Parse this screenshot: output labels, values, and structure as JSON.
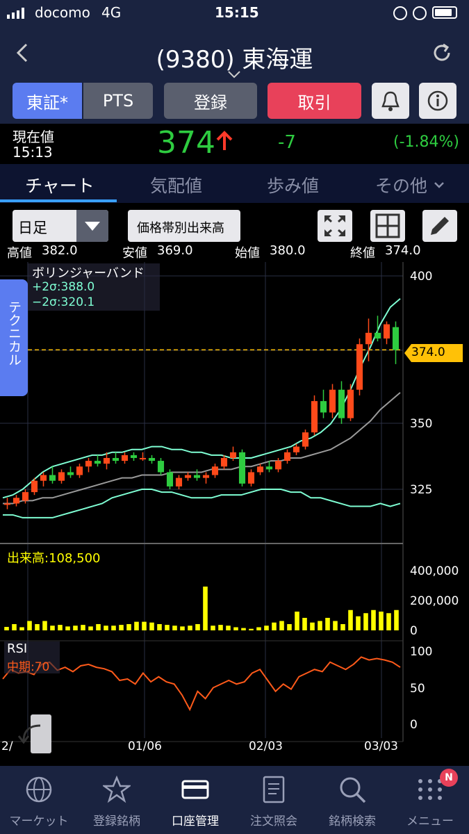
{
  "status": {
    "carrier": "docomo",
    "network": "4G",
    "time": "15:15"
  },
  "nav": {
    "title": "(9380) 東海運"
  },
  "buttons": {
    "tse": "東証*",
    "pts": "PTS",
    "register": "登録",
    "trade": "取引"
  },
  "price": {
    "label": "現在値",
    "time": "15:13",
    "value": "374",
    "change": "-7",
    "change_pct": "(-1.84%)"
  },
  "tabs": [
    "チャート",
    "気配値",
    "歩み値",
    "その他"
  ],
  "chart_tools": {
    "period": "日足",
    "volume_btn": "価格帯別出来高"
  },
  "ohlc": {
    "high_label": "高値",
    "high": "382.0",
    "low_label": "安値",
    "low": "369.0",
    "open_label": "始値",
    "open": "380.0",
    "close_label": "終値",
    "close": "374.0"
  },
  "indicator": {
    "name": "ボリンジャーバンド",
    "upper": "+2σ:388.0",
    "lower": "−2σ:320.1"
  },
  "side_tab": "テクニカル",
  "price_marker": "374.0",
  "volume_label": "出来高:108,500",
  "rsi_label": "RSI",
  "rsi_sub": "中期:70",
  "colors": {
    "up": "#ff4a1a",
    "down": "#2ecc40",
    "band": "#7fffd4",
    "ma": "#9a9a9a",
    "volume": "#ffff00",
    "rsi": "#ff5a1a",
    "accent": "#5b7cf0",
    "trade": "#e8415a"
  },
  "chart_data": [
    {
      "type": "candlestick",
      "y_ticks": [
        "400",
        "350",
        "325"
      ],
      "x_labels": [
        "2/",
        "01/06",
        "02/03",
        "03/03"
      ],
      "current_price": 374.0,
      "upper_band": [
        322,
        323,
        325,
        328,
        331,
        333,
        334,
        335,
        336,
        337,
        337,
        338,
        338,
        339,
        339,
        340,
        340,
        339,
        339,
        338,
        338,
        337,
        337,
        336,
        336,
        336,
        337,
        338,
        339,
        340,
        342,
        343,
        345,
        348,
        353,
        360,
        368,
        375,
        383,
        389,
        392
      ],
      "middle": [
        320,
        320,
        321,
        321,
        322,
        322,
        323,
        324,
        325,
        326,
        327,
        328,
        329,
        329,
        330,
        330,
        330,
        331,
        331,
        331,
        331,
        332,
        332,
        332,
        333,
        333,
        334,
        335,
        335,
        336,
        336,
        337,
        338,
        339,
        341,
        343,
        346,
        349,
        353,
        356,
        359
      ],
      "lower_band": [
        316,
        316,
        315,
        315,
        315,
        315,
        316,
        317,
        318,
        319,
        320,
        322,
        323,
        324,
        325,
        325,
        324,
        324,
        323,
        322,
        322,
        322,
        323,
        323,
        323,
        324,
        325,
        325,
        325,
        324,
        324,
        322,
        322,
        321,
        320,
        319,
        319,
        319,
        320,
        319,
        320
      ],
      "candles": [
        {
          "o": 320,
          "h": 322,
          "l": 318,
          "c": 320
        },
        {
          "o": 320,
          "h": 323,
          "l": 319,
          "c": 322
        },
        {
          "o": 321,
          "h": 325,
          "l": 320,
          "c": 324
        },
        {
          "o": 324,
          "h": 329,
          "l": 323,
          "c": 328
        },
        {
          "o": 328,
          "h": 331,
          "l": 326,
          "c": 330
        },
        {
          "o": 330,
          "h": 333,
          "l": 327,
          "c": 328
        },
        {
          "o": 328,
          "h": 332,
          "l": 327,
          "c": 331
        },
        {
          "o": 331,
          "h": 333,
          "l": 329,
          "c": 330
        },
        {
          "o": 330,
          "h": 334,
          "l": 329,
          "c": 333
        },
        {
          "o": 333,
          "h": 336,
          "l": 331,
          "c": 335
        },
        {
          "o": 335,
          "h": 337,
          "l": 333,
          "c": 334
        },
        {
          "o": 334,
          "h": 338,
          "l": 332,
          "c": 336
        },
        {
          "o": 336,
          "h": 338,
          "l": 334,
          "c": 335
        },
        {
          "o": 335,
          "h": 338,
          "l": 334,
          "c": 337
        },
        {
          "o": 337,
          "h": 338,
          "l": 335,
          "c": 336
        },
        {
          "o": 336,
          "h": 338,
          "l": 335,
          "c": 336
        },
        {
          "o": 336,
          "h": 337,
          "l": 334,
          "c": 335
        },
        {
          "o": 335,
          "h": 336,
          "l": 330,
          "c": 331
        },
        {
          "o": 331,
          "h": 332,
          "l": 325,
          "c": 326
        },
        {
          "o": 326,
          "h": 330,
          "l": 325,
          "c": 329
        },
        {
          "o": 329,
          "h": 331,
          "l": 328,
          "c": 330
        },
        {
          "o": 330,
          "h": 332,
          "l": 328,
          "c": 329
        },
        {
          "o": 329,
          "h": 331,
          "l": 327,
          "c": 330
        },
        {
          "o": 330,
          "h": 334,
          "l": 329,
          "c": 333
        },
        {
          "o": 333,
          "h": 337,
          "l": 332,
          "c": 336
        },
        {
          "o": 336,
          "h": 340,
          "l": 335,
          "c": 338
        },
        {
          "o": 338,
          "h": 339,
          "l": 326,
          "c": 327
        },
        {
          "o": 327,
          "h": 332,
          "l": 326,
          "c": 331
        },
        {
          "o": 331,
          "h": 334,
          "l": 330,
          "c": 333
        },
        {
          "o": 333,
          "h": 335,
          "l": 331,
          "c": 332
        },
        {
          "o": 332,
          "h": 336,
          "l": 331,
          "c": 335
        },
        {
          "o": 335,
          "h": 339,
          "l": 334,
          "c": 338
        },
        {
          "o": 338,
          "h": 341,
          "l": 337,
          "c": 340
        },
        {
          "o": 340,
          "h": 346,
          "l": 339,
          "c": 345
        },
        {
          "o": 345,
          "h": 358,
          "l": 344,
          "c": 356
        },
        {
          "o": 356,
          "h": 360,
          "l": 350,
          "c": 352
        },
        {
          "o": 352,
          "h": 362,
          "l": 350,
          "c": 360
        },
        {
          "o": 360,
          "h": 363,
          "l": 348,
          "c": 350
        },
        {
          "o": 350,
          "h": 362,
          "l": 349,
          "c": 360
        },
        {
          "o": 360,
          "h": 378,
          "l": 358,
          "c": 376
        },
        {
          "o": 376,
          "h": 385,
          "l": 370,
          "c": 380
        },
        {
          "o": 380,
          "h": 386,
          "l": 377,
          "c": 378
        },
        {
          "o": 378,
          "h": 384,
          "l": 376,
          "c": 383
        },
        {
          "o": 382,
          "h": 384,
          "l": 369,
          "c": 374
        }
      ]
    },
    {
      "type": "bar",
      "name": "出来高",
      "y_ticks": [
        "400,000",
        "200,000",
        "0"
      ],
      "ylim": [
        0,
        400000
      ],
      "values": [
        22000,
        40000,
        20000,
        60000,
        40000,
        60000,
        30000,
        35000,
        25000,
        30000,
        35000,
        25000,
        40000,
        30000,
        30000,
        35000,
        40000,
        55000,
        55000,
        50000,
        40000,
        35000,
        30000,
        25000,
        30000,
        40000,
        280000,
        30000,
        35000,
        30000,
        20000,
        15000,
        10000,
        20000,
        30000,
        50000,
        60000,
        40000,
        120000,
        80000,
        50000,
        60000,
        80000,
        60000,
        40000,
        130000,
        90000,
        110000,
        130000,
        120000,
        110000,
        130000
      ]
    },
    {
      "type": "line",
      "name": "RSI",
      "y_ticks": [
        "100",
        "50",
        "0"
      ],
      "ylim": [
        0,
        100
      ],
      "values": [
        62,
        75,
        70,
        72,
        68,
        82,
        85,
        74,
        78,
        72,
        80,
        82,
        78,
        76,
        72,
        60,
        62,
        55,
        70,
        58,
        65,
        58,
        55,
        40,
        20,
        45,
        35,
        50,
        55,
        60,
        55,
        58,
        70,
        75,
        60,
        45,
        55,
        48,
        65,
        70,
        75,
        72,
        85,
        80,
        75,
        82,
        92,
        88,
        90,
        88,
        85,
        78
      ]
    }
  ],
  "bottom_nav": [
    "マーケット",
    "登録銘柄",
    "口座管理",
    "注文照会",
    "銘柄検索",
    "メニュー"
  ],
  "badge": "N"
}
